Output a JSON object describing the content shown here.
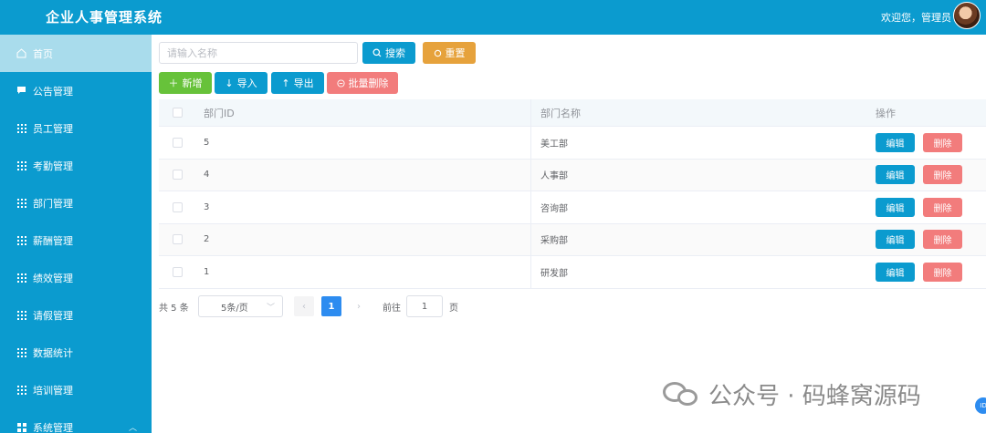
{
  "header": {
    "title": "企业人事管理系统",
    "welcome": "欢迎您，管理员"
  },
  "sidebar": {
    "items": [
      {
        "label": "首页",
        "icon": "home-icon"
      },
      {
        "label": "公告管理",
        "icon": "message-icon"
      },
      {
        "label": "员工管理",
        "icon": "grid-icon"
      },
      {
        "label": "考勤管理",
        "icon": "grid-icon"
      },
      {
        "label": "部门管理",
        "icon": "grid-icon"
      },
      {
        "label": "薪酬管理",
        "icon": "grid-icon"
      },
      {
        "label": "绩效管理",
        "icon": "grid-icon"
      },
      {
        "label": "请假管理",
        "icon": "grid-icon"
      },
      {
        "label": "数据统计",
        "icon": "grid-icon"
      },
      {
        "label": "培训管理",
        "icon": "grid-icon"
      },
      {
        "label": "系统管理",
        "icon": "grid-icon"
      }
    ]
  },
  "search": {
    "placeholder": "请输入名称"
  },
  "toolbar": {
    "search_label": "搜索",
    "reset_label": "重置",
    "add_label": "新增",
    "import_label": "导入",
    "export_label": "导出",
    "batch_delete_label": "批量删除"
  },
  "table": {
    "headers": {
      "id": "部门ID",
      "name": "部门名称",
      "ops": "操作"
    },
    "edit_label": "编辑",
    "delete_label": "删除",
    "rows": [
      {
        "id": "5",
        "name": "美工部"
      },
      {
        "id": "4",
        "name": "人事部"
      },
      {
        "id": "3",
        "name": "咨询部"
      },
      {
        "id": "2",
        "name": "采购部"
      },
      {
        "id": "1",
        "name": "研发部"
      }
    ]
  },
  "pagination": {
    "total": "共 5 条",
    "page_size": "5条/页",
    "current_page": "1",
    "goto_label": "前往",
    "goto_value": "1",
    "unit": "页"
  },
  "watermark": {
    "text": "公众号 · 码蜂窝源码"
  },
  "colors": {
    "primary": "#0b9bcf",
    "success": "#67c23a",
    "warning": "#e6a23c",
    "danger": "#f27c7c",
    "page_active": "#2d8cf0"
  }
}
